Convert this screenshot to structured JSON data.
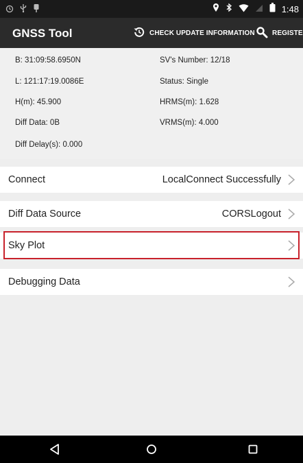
{
  "status_bar": {
    "time": "1:48",
    "icons_left": [
      "clock-icon",
      "usb-icon",
      "notification-icon"
    ],
    "icons_right": [
      "location-icon",
      "bluetooth-icon",
      "wifi-icon",
      "signal-icon",
      "battery-icon"
    ]
  },
  "app_bar": {
    "title": "GNSS Tool",
    "check_update_label": "CHECK UPDATE INFORMATION",
    "register_label": "REGISTER"
  },
  "info": {
    "b": "B:   31:09:58.6950N",
    "l": "L:   121:17:19.0086E",
    "h": "H(m):   45.900",
    "diff_data": "Diff Data:  0B",
    "diff_delay": "Diff Delay(s):  0.000",
    "sv_number": "SV's Number:  12/18",
    "status": "Status:  Single",
    "hrms": "HRMS(m):  1.628",
    "vrms": "VRMS(m):  4.000"
  },
  "list": [
    {
      "label": "Connect",
      "value": "LocalConnect Successfully"
    },
    {
      "label": "Diff Data Source",
      "value": "CORSLogout"
    },
    {
      "label": "Sky Plot",
      "value": ""
    },
    {
      "label": "Debugging Data",
      "value": ""
    }
  ],
  "colors": {
    "app_bar": "#2b2b2b",
    "status_bar": "#1a1a1a",
    "highlight": "#c8202a",
    "background": "#eeeeee"
  }
}
